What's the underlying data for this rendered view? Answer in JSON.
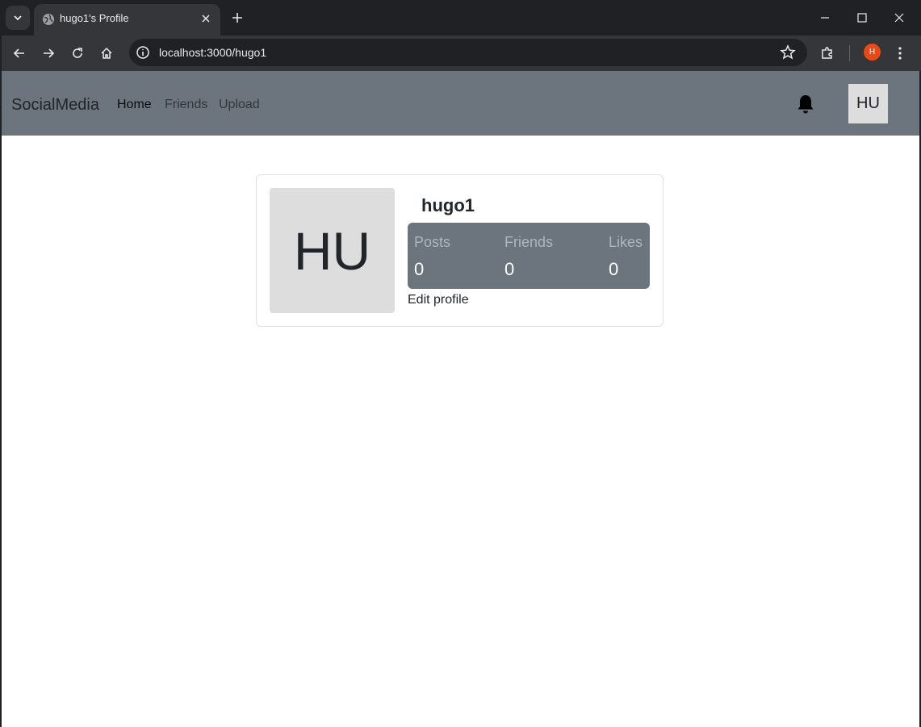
{
  "browser": {
    "tab_title": "hugo1's Profile",
    "url": "localhost:3000/hugo1",
    "profile_initial": "H"
  },
  "navbar": {
    "brand": "SocialMedia",
    "links": [
      "Home",
      "Friends",
      "Upload"
    ],
    "active_link": "Home",
    "avatar_initials": "HU"
  },
  "profile": {
    "avatar_initials": "HU",
    "username": "hugo1",
    "stats": [
      {
        "label": "Posts",
        "value": "0"
      },
      {
        "label": "Friends",
        "value": "0"
      },
      {
        "label": "Likes",
        "value": "0"
      }
    ],
    "edit_label": "Edit profile"
  },
  "colors": {
    "navbar_bg": "#6c757d",
    "stats_bg": "#6c757d",
    "avatar_bg": "#dddddd",
    "profile_badge": "#e64a19"
  }
}
